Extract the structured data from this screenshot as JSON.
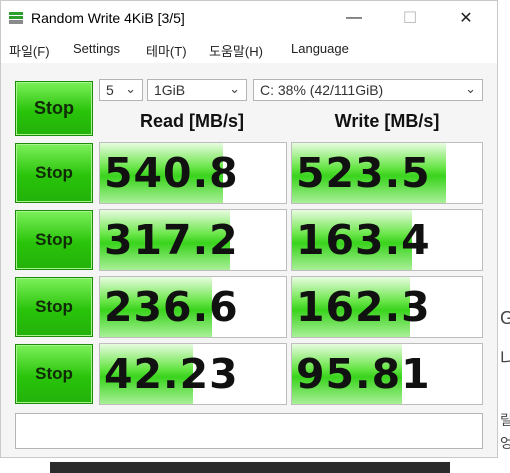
{
  "window": {
    "title": "Random Write 4KiB [3/5]",
    "minimize_glyph": "—",
    "maximize_glyph": "☐",
    "close_glyph": "✕"
  },
  "menu": [
    {
      "label": "파일(F)"
    },
    {
      "label": "Settings"
    },
    {
      "label": "테마(T)"
    },
    {
      "label": "도움말(H)"
    },
    {
      "label": "Language"
    }
  ],
  "controls": {
    "stop_all_label": "Stop",
    "count": "5",
    "size": "1GiB",
    "drive": "C: 38% (42/111GiB)"
  },
  "headers": {
    "read": "Read [MB/s]",
    "write": "Write [MB/s]"
  },
  "rows": [
    {
      "stop_label": "Stop",
      "read": "540.8",
      "write": "523.5",
      "read_fill": 0.66,
      "write_fill": 0.81
    },
    {
      "stop_label": "Stop",
      "read": "317.2",
      "write": "163.4",
      "read_fill": 0.7,
      "write_fill": 0.63
    },
    {
      "stop_label": "Stop",
      "read": "236.6",
      "write": "162.3",
      "read_fill": 0.6,
      "write_fill": 0.62
    },
    {
      "stop_label": "Stop",
      "read": "42.23",
      "write": "95.81",
      "read_fill": 0.5,
      "write_fill": 0.58
    }
  ],
  "comment": "",
  "background_glyphs": [
    "G",
    "냐",
    "릴",
    "엉"
  ],
  "colors": {
    "stop_green": "#29c40a",
    "bar_green": "#39d31c"
  }
}
